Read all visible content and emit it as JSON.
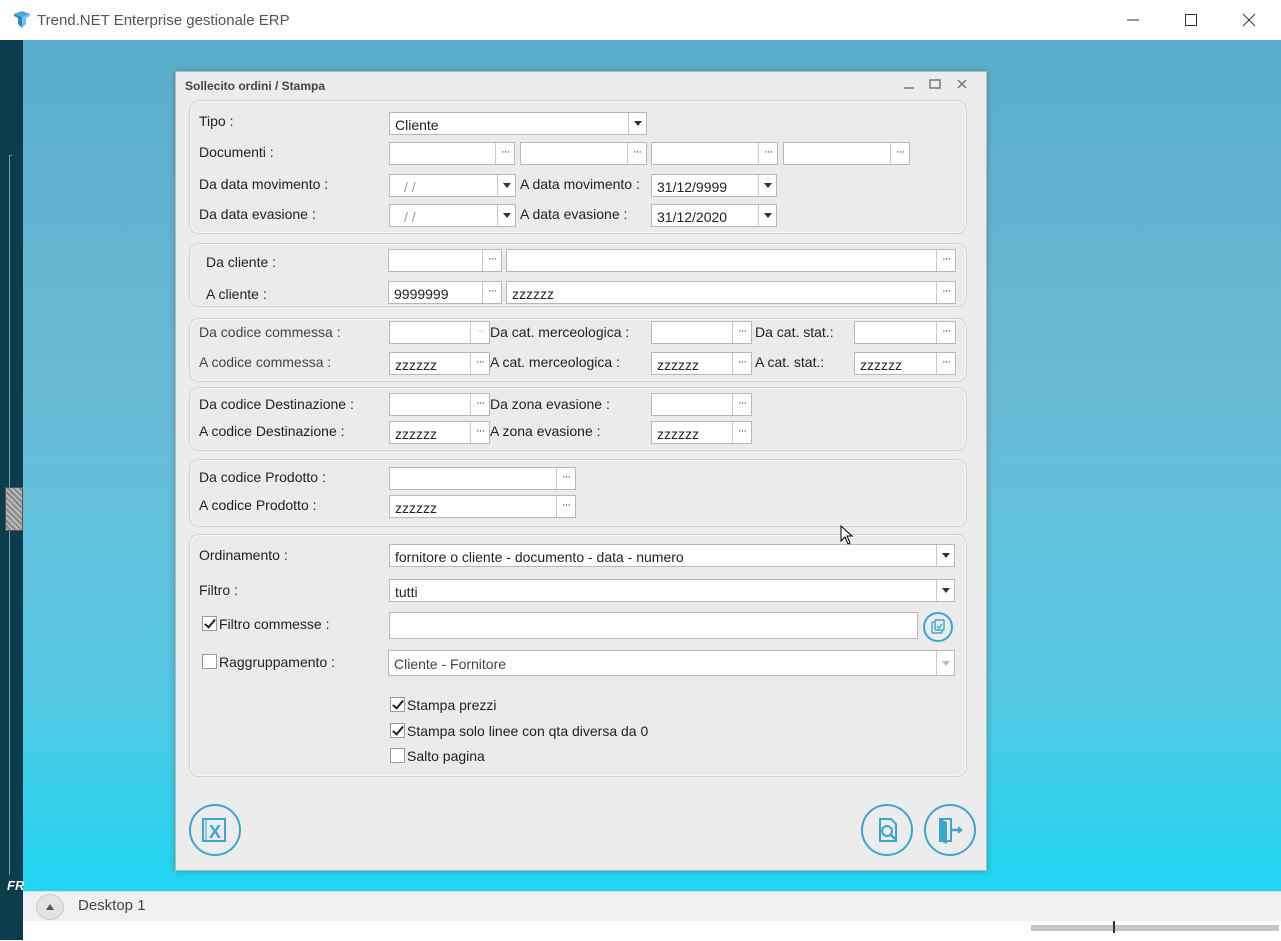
{
  "window": {
    "title": "Trend.NET Enterprise gestionale ERP"
  },
  "dialog": {
    "title": "Sollecito ordini / Stampa"
  },
  "section1": {
    "tipo_label": "Tipo :",
    "tipo_value": "Cliente",
    "documenti_label": "Documenti :",
    "documenti_values": [
      "",
      "",
      "",
      ""
    ],
    "da_data_mov_label": "Da data movimento :",
    "da_data_mov_value": "/ /",
    "a_data_mov_label": "A data movimento :",
    "a_data_mov_value": "31/12/9999",
    "da_data_eva_label": "Da data evasione :",
    "da_data_eva_value": "/ /",
    "a_data_eva_label": "A data evasione :",
    "a_data_eva_value": "31/12/2020"
  },
  "section2": {
    "da_cliente_label": "Da cliente :",
    "da_cliente_code": "",
    "da_cliente_name": "",
    "a_cliente_label": "A cliente :",
    "a_cliente_code": "9999999",
    "a_cliente_name": "zzzzzz"
  },
  "section3": {
    "da_commessa_label": "Da codice commessa :",
    "da_commessa_value": "",
    "a_commessa_label": "A codice commessa :",
    "a_commessa_value": "zzzzzz",
    "da_catmerc_label": "Da cat. merceologica :",
    "da_catmerc_value": "",
    "a_catmerc_label": "A cat. merceologica :",
    "a_catmerc_value": "zzzzzz",
    "da_catstat_label": "Da cat. stat.:",
    "da_catstat_value": "",
    "a_catstat_label": "A cat. stat.:",
    "a_catstat_value": "zzzzzz"
  },
  "section4": {
    "da_dest_label": "Da codice Destinazione :",
    "da_dest_value": "",
    "a_dest_label": "A codice Destinazione :",
    "a_dest_value": "zzzzzz",
    "da_zona_label": "Da zona evasione :",
    "da_zona_value": "",
    "a_zona_label": "A zona evasione :",
    "a_zona_value": "zzzzzz"
  },
  "section5": {
    "da_prod_label": "Da codice Prodotto :",
    "da_prod_value": "",
    "a_prod_label": "A codice Prodotto :",
    "a_prod_value": "zzzzzz"
  },
  "section6": {
    "ordinamento_label": "Ordinamento :",
    "ordinamento_value": "fornitore o cliente - documento - data - numero",
    "filtro_label": "Filtro :",
    "filtro_value": "tutti",
    "filtro_commesse_label": "Filtro commesse :",
    "filtro_commesse_checked": true,
    "filtro_commesse_value": "",
    "raggruppamento_label": "Raggruppamento  :",
    "raggruppamento_checked": false,
    "raggruppamento_value": "Cliente - Fornitore",
    "stampa_prezzi_label": "Stampa prezzi",
    "stampa_prezzi_checked": true,
    "stampa_solo_linee_label": "Stampa solo linee con qta diversa da 0",
    "stampa_solo_linee_checked": true,
    "salto_pagina_label": "Salto pagina",
    "salto_pagina_checked": false
  },
  "taskbar": {
    "desktop_label": "Desktop 1",
    "sidebar_text": "FR"
  },
  "colors": {
    "accent": "#3aa6cf",
    "dialog_bg": "#ececec",
    "desktop_top": "#5aaecb",
    "desktop_bottom": "#1fd6f2"
  },
  "icons": {
    "app": "trend-logo-icon",
    "export": "excel-export-icon",
    "preview": "print-preview-icon",
    "exit": "exit-door-icon",
    "filter_select": "filter-select-icon"
  }
}
